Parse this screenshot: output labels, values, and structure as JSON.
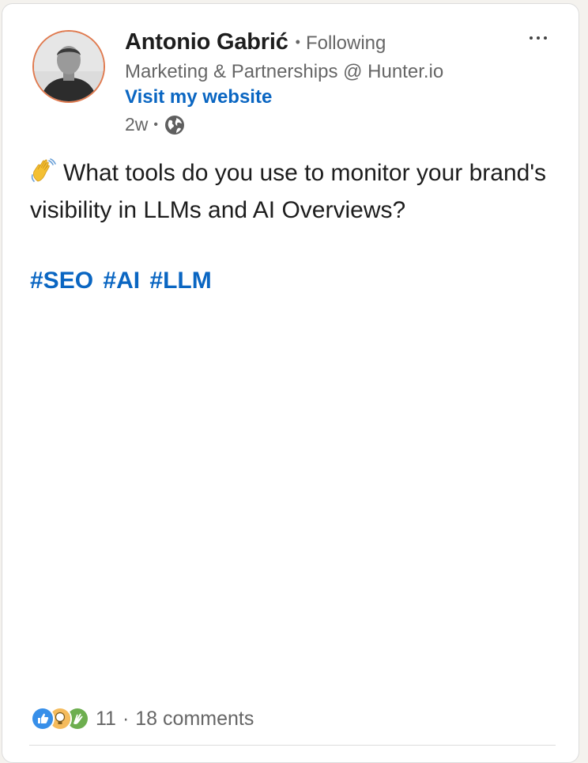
{
  "post": {
    "author": {
      "name": "Antonio Gabrić",
      "separator": "•",
      "follow_status": "Following",
      "headline": "Marketing & Partnerships @ Hunter.io",
      "link_label": "Visit my website",
      "avatar_icon": "user-photo"
    },
    "meta": {
      "time_ago": "2w",
      "separator": "•",
      "visibility_icon": "globe-icon"
    },
    "menu_icon": "more-horizontal-icon",
    "text": "What tools do you use to monitor your brand's visibility in LLMs and AI Overviews?",
    "emoji_icon": "waving-hand-icon",
    "hashtags": [
      "#SEO",
      "#AI",
      "#LLM"
    ],
    "social": {
      "reaction_icons": [
        "like-icon",
        "insightful-icon",
        "celebrate-icon"
      ],
      "reaction_count": "11",
      "separator": "·",
      "comments": "18 comments"
    }
  },
  "colors": {
    "link": "#0a66c2",
    "text_primary": "#1d1d1d",
    "text_secondary": "#666666",
    "avatar_ring": "#e07a4f"
  }
}
